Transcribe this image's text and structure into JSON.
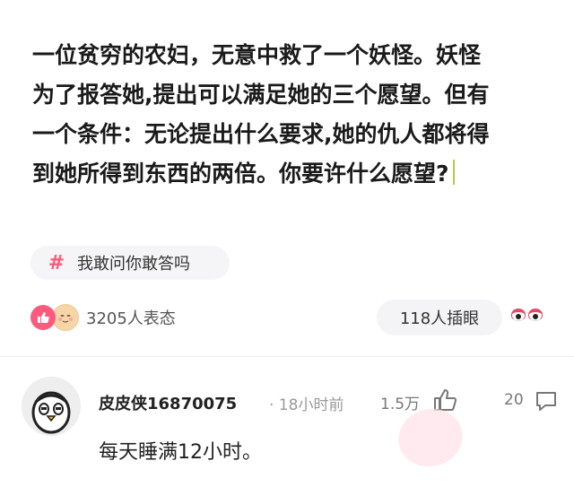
{
  "post": {
    "lines": [
      "一位贫穷的农妇，无意中救了一个妖怪。妖怪",
      "为了报答她,提出可以满足她的三个愿望。但有",
      "一个条件：无论提出什么要求,她的仇人都将得",
      "到她所得到东西的两倍。你要许什么愿望?"
    ]
  },
  "topic": {
    "hash": "#",
    "label": "我敢问你敢答吗"
  },
  "reactions": {
    "count_text": "3205人表态",
    "eyes_text": "118人插眼"
  },
  "comment": {
    "username": "皮皮侠16870075",
    "time": "· 18小时前",
    "likes": "1.5万",
    "replies": "20",
    "text": "每天睡满12小时。"
  },
  "colors": {
    "accent_pink": "#ff5a7e",
    "chip_bg": "#f5f5f7"
  },
  "icons": [
    "like-icon",
    "face-icon",
    "eyes-icon",
    "thumb-up-icon",
    "reply-icon",
    "avatar-penguin"
  ]
}
